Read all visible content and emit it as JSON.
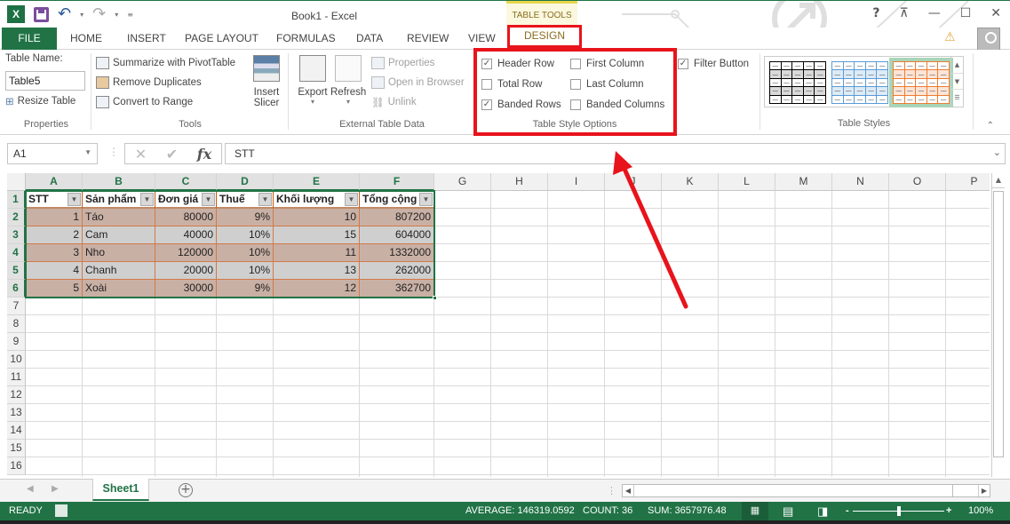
{
  "window": {
    "title": "Book1 - Excel",
    "context_tab_group": "TABLE TOOLS",
    "controls": [
      "?",
      "restore-ribbon",
      "minimize",
      "maximize",
      "close"
    ]
  },
  "qat": {
    "app_icon": "X",
    "icons": [
      "save-icon",
      "undo-icon",
      "redo-icon",
      "customize-icon"
    ]
  },
  "tabs": [
    {
      "label": "FILE"
    },
    {
      "label": "HOME"
    },
    {
      "label": "INSERT"
    },
    {
      "label": "PAGE LAYOUT"
    },
    {
      "label": "FORMULAS"
    },
    {
      "label": "DATA"
    },
    {
      "label": "REVIEW"
    },
    {
      "label": "VIEW"
    },
    {
      "label": "DESIGN",
      "active": true
    }
  ],
  "ribbon": {
    "properties": {
      "label": "Properties",
      "table_name_label": "Table Name:",
      "table_name_value": "Table5",
      "resize_table": "Resize Table"
    },
    "tools": {
      "label": "Tools",
      "summarize": "Summarize with PivotTable",
      "remove_duplicates": "Remove Duplicates",
      "convert_to_range": "Convert to Range",
      "insert_slicer_1": "Insert",
      "insert_slicer_2": "Slicer"
    },
    "external": {
      "label": "External Table Data",
      "export": "Export",
      "refresh": "Refresh",
      "properties": "Properties",
      "open_in_browser": "Open in Browser",
      "unlink": "Unlink"
    },
    "style_options": {
      "label": "Table Style Options",
      "options": [
        {
          "label": "Header Row",
          "checked": true
        },
        {
          "label": "Total Row",
          "checked": false
        },
        {
          "label": "Banded Rows",
          "checked": true
        },
        {
          "label": "First Column",
          "checked": false
        },
        {
          "label": "Last Column",
          "checked": false
        },
        {
          "label": "Banded Columns",
          "checked": false
        },
        {
          "label": "Filter Button",
          "checked": true
        }
      ]
    },
    "table_styles": {
      "label": "Table Styles",
      "styles": [
        {
          "name": "Black Medium",
          "header": "#ffffff",
          "band": "#d9d9d9",
          "border": "#000000"
        },
        {
          "name": "Blue Light",
          "header": "#ffffff",
          "band": "#ddebf7",
          "border": "#5b9bd5"
        },
        {
          "name": "Orange Light",
          "header": "#ffffff",
          "band": "#fce4d6",
          "border": "#ed7d31",
          "selected": true
        }
      ]
    }
  },
  "formula_bar": {
    "name_box": "A1",
    "formula": "STT"
  },
  "sheet": {
    "columns": [
      "A",
      "B",
      "C",
      "D",
      "E",
      "F",
      "G",
      "H",
      "I",
      "J",
      "K",
      "L",
      "M",
      "N",
      "O",
      "P"
    ],
    "rows": [
      "1",
      "2",
      "3",
      "4",
      "5",
      "6",
      "7",
      "8",
      "9",
      "10",
      "11",
      "12",
      "13",
      "14",
      "15",
      "16"
    ],
    "table": {
      "headers": [
        "STT",
        "Sản phẩm",
        "Đơn giá",
        "Thuế",
        "Khối lượng",
        "Tổng cộng"
      ],
      "rows": [
        [
          "1",
          "Táo",
          "80000",
          "9%",
          "10",
          "807200"
        ],
        [
          "2",
          "Cam",
          "40000",
          "10%",
          "15",
          "604000"
        ],
        [
          "3",
          "Nho",
          "120000",
          "10%",
          "11",
          "1332000"
        ],
        [
          "4",
          "Chanh",
          "20000",
          "10%",
          "13",
          "262000"
        ],
        [
          "5",
          "Xoài",
          "30000",
          "9%",
          "12",
          "362700"
        ]
      ]
    }
  },
  "sheet_tabs": {
    "active": "Sheet1"
  },
  "status_bar": {
    "mode": "READY",
    "average": "AVERAGE: 146319.0592",
    "count": "COUNT: 36",
    "sum": "SUM: 3657976.48",
    "zoom": "100%"
  },
  "colors": {
    "excel_green": "#217346",
    "annotation_red": "#e8131b",
    "band_row_1": "#c9b0a5",
    "band_row_2": "#cfcfcf"
  }
}
